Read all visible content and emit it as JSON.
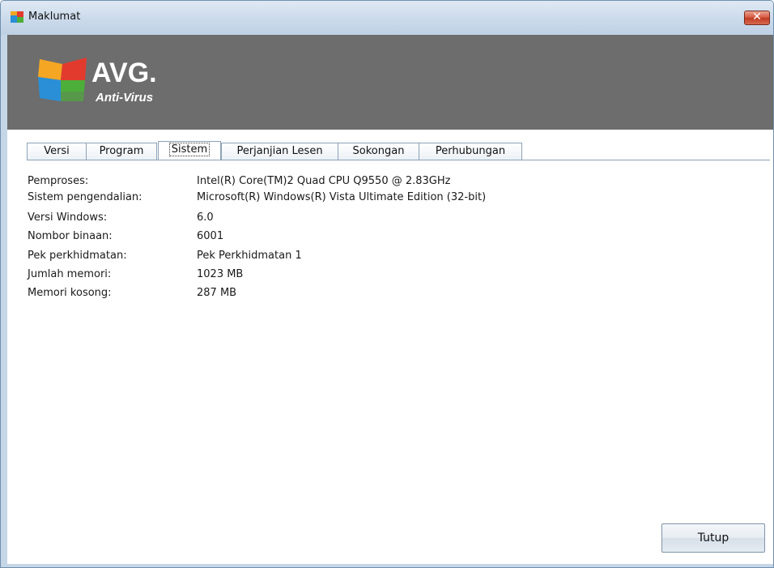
{
  "window": {
    "title": "Maklumat",
    "close_glyph": "✕"
  },
  "banner": {
    "brand": "AVG.",
    "product": "Anti-Virus"
  },
  "tabs": [
    {
      "label": "Versi",
      "active": false
    },
    {
      "label": "Program",
      "active": false
    },
    {
      "label": "Sistem",
      "active": true
    },
    {
      "label": "Perjanjian Lesen",
      "active": false
    },
    {
      "label": "Sokongan",
      "active": false
    },
    {
      "label": "Perhubungan",
      "active": false
    }
  ],
  "system_info": [
    {
      "label": "Pemproses:",
      "value": "Intel(R) Core(TM)2 Quad CPU    Q9550  @ 2.83GHz"
    },
    {
      "label": "Sistem pengendalian:",
      "value": "Microsoft(R) Windows(R) Vista Ultimate Edition (32-bit)"
    },
    {
      "label": "Versi Windows:",
      "value": "6.0"
    },
    {
      "label": "Nombor binaan:",
      "value": "6001"
    },
    {
      "label": "Pek perkhidmatan:",
      "value": "Pek Perkhidmatan 1"
    },
    {
      "label": "Jumlah memori:",
      "value": "1023 MB"
    },
    {
      "label": "Memori kosong:",
      "value": "287 MB"
    }
  ],
  "buttons": {
    "close_label": "Tutup"
  },
  "colors": {
    "banner": "#6d6d6d",
    "tab_border": "#8da2b8",
    "window_frame": "#c5d6e6"
  },
  "icons": {
    "app": "avg-logo-icon",
    "close": "close-icon"
  }
}
